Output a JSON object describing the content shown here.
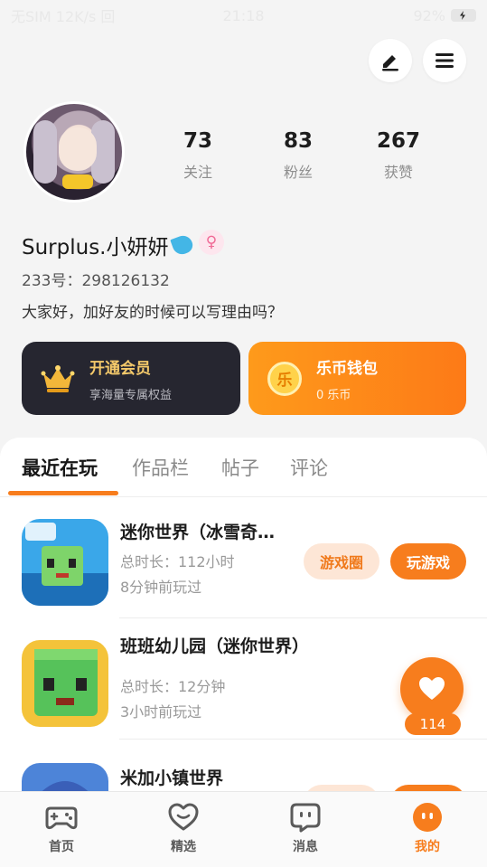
{
  "status_bar": {
    "left": "无SIM 12K/s 回",
    "time": "21:18",
    "right": "92%"
  },
  "profile": {
    "stats": [
      {
        "value": "73",
        "label": "关注"
      },
      {
        "value": "83",
        "label": "粉丝"
      },
      {
        "value": "267",
        "label": "获赞"
      }
    ],
    "nickname": "Surplus.小妍妍",
    "gender_symbol": "♀",
    "uid": "233号：298126132",
    "bio": "大家好，加好友的时候可以写理由吗？"
  },
  "cards": {
    "vip": {
      "title": "开通会员",
      "subtitle": "享海量专属权益"
    },
    "wallet": {
      "coin_char": "乐",
      "title": "乐币钱包",
      "subtitle": "0 乐币"
    }
  },
  "tabs": [
    "最近在玩",
    "作品栏",
    "帖子",
    "评论"
  ],
  "games": [
    {
      "name": "迷你世界（冰雪奇…",
      "duration": "总时长：112小时",
      "last_played": "8分钟前玩过",
      "btn_circle": "游戏圈",
      "btn_play": "玩游戏"
    },
    {
      "name": "班班幼儿园（迷你世界）",
      "duration": "总时长：12分钟",
      "last_played": "3小时前玩过"
    },
    {
      "name": "米加小镇世界"
    }
  ],
  "like_count": "114",
  "bottom_nav": [
    "首页",
    "精选",
    "消息",
    "我的"
  ],
  "colors": {
    "accent": "#f77d1d",
    "vip_bg": "#262630",
    "vip_text": "#f4c96a"
  }
}
